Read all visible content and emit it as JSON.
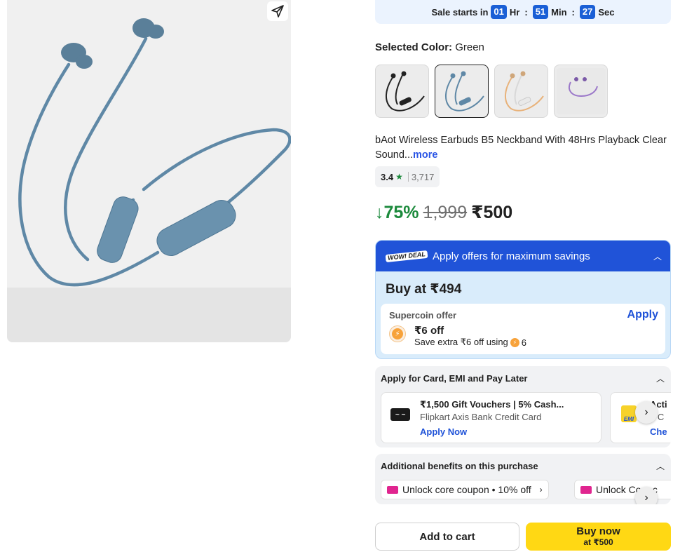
{
  "sale": {
    "label": "Sale starts in",
    "hours": "01",
    "hours_unit": "Hr",
    "minutes": "51",
    "minutes_unit": "Min",
    "seconds": "27",
    "seconds_unit": "Sec",
    "separator": ":"
  },
  "color": {
    "label": "Selected Color:",
    "value": "Green",
    "swatches": [
      "black",
      "green",
      "beige",
      "purple"
    ],
    "selected_index": 1
  },
  "product": {
    "title": "bAot Wireless Earbuds B5 Neckband With 48Hrs Playback Clear Sound...",
    "more": "more"
  },
  "rating": {
    "value": "3.4",
    "star": "★",
    "count": "3,717"
  },
  "price": {
    "discount": "↓75%",
    "mrp": "1,999",
    "final": "₹500"
  },
  "offers": {
    "badge": "WOW! DEAL",
    "header": "Apply offers for maximum savings",
    "buy_at": "Buy at ₹494",
    "supercoin_label": "Supercoin offer",
    "apply": "Apply",
    "off": "₹6 off",
    "extra": "Save extra ₹6 off using",
    "coins": "6"
  },
  "card_section": {
    "title": "Apply for Card, EMI and Pay Later",
    "items": [
      {
        "title": "₹1,500 Gift Vouchers | 5% Cash...",
        "subtitle": "Flipkart Axis Bank Credit Card",
        "cta": "Apply Now"
      },
      {
        "title": "Acti",
        "subtitle": "o C",
        "cta": "Che"
      }
    ]
  },
  "benefits": {
    "title": "Additional benefits on this purchase",
    "pills": [
      "Unlock core coupon • 10% off",
      "Unlock Core c"
    ]
  },
  "actions": {
    "add_to_cart": "Add to cart",
    "buy_now": "Buy now",
    "buy_now_price": "at ₹500"
  },
  "colors": {
    "accent_blue": "#2053d8",
    "discount_green": "#1c8a3c",
    "buy_yellow": "#ffd814"
  }
}
